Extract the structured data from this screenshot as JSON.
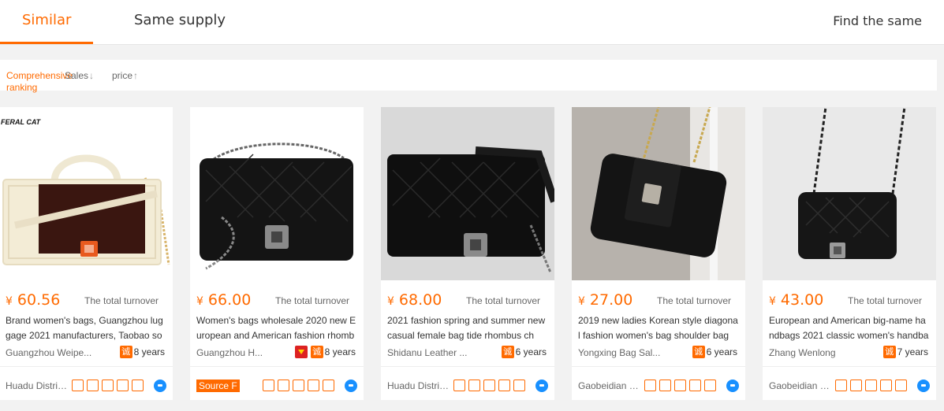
{
  "tabs": [
    {
      "label": "Similar",
      "active": true
    },
    {
      "label": "Same supply",
      "active": false
    }
  ],
  "find_same": "Find the same",
  "sort": [
    {
      "label": "Comprehensive ranking",
      "active": true,
      "arrow": ""
    },
    {
      "label": "Sales",
      "active": false,
      "arrow": "↓"
    },
    {
      "label": "price",
      "active": false,
      "arrow": "↑"
    }
  ],
  "products": [
    {
      "currency": "¥",
      "price": "60.56",
      "turnover": "The total turnover",
      "title": "Brand women's bags, Guangzhou luggage 2021 manufacturers, Taobao so",
      "shop": "Guangzhou Weipe...",
      "years": "8 years",
      "location": "Huadu District...",
      "brand_logo": "FERAL CAT"
    },
    {
      "currency": "¥",
      "price": "66.00",
      "turnover": "The total turnover",
      "title": "Women's bags wholesale 2020 new European and American fashion rhomb",
      "shop": "Guangzhou H...",
      "years": "8 years",
      "source_badge": "Source F"
    },
    {
      "currency": "¥",
      "price": "68.00",
      "turnover": "The total turnover",
      "title": "2021 fashion spring and summer new casual female bag tide rhombus ch",
      "shop": "Shidanu Leather ...",
      "years": "6 years",
      "location": "Huadu District..."
    },
    {
      "currency": "¥",
      "price": "27.00",
      "turnover": "The total turnover",
      "title": "2019 new ladies Korean style diagonal fashion women's bag shoulder bag",
      "shop": "Yongxing Bag Sal...",
      "years": "6 years",
      "location": "Gaobeidian Ci..."
    },
    {
      "currency": "¥",
      "price": "43.00",
      "turnover": "The total turnover",
      "title": "European and American big-name handbags 2021 classic women's handba",
      "shop": "Zhang Wenlong",
      "years": "7 years",
      "location": "Gaobeidian Ci..."
    }
  ],
  "colors": {
    "accent": "#ff6a00",
    "chat": "#1890ff"
  }
}
